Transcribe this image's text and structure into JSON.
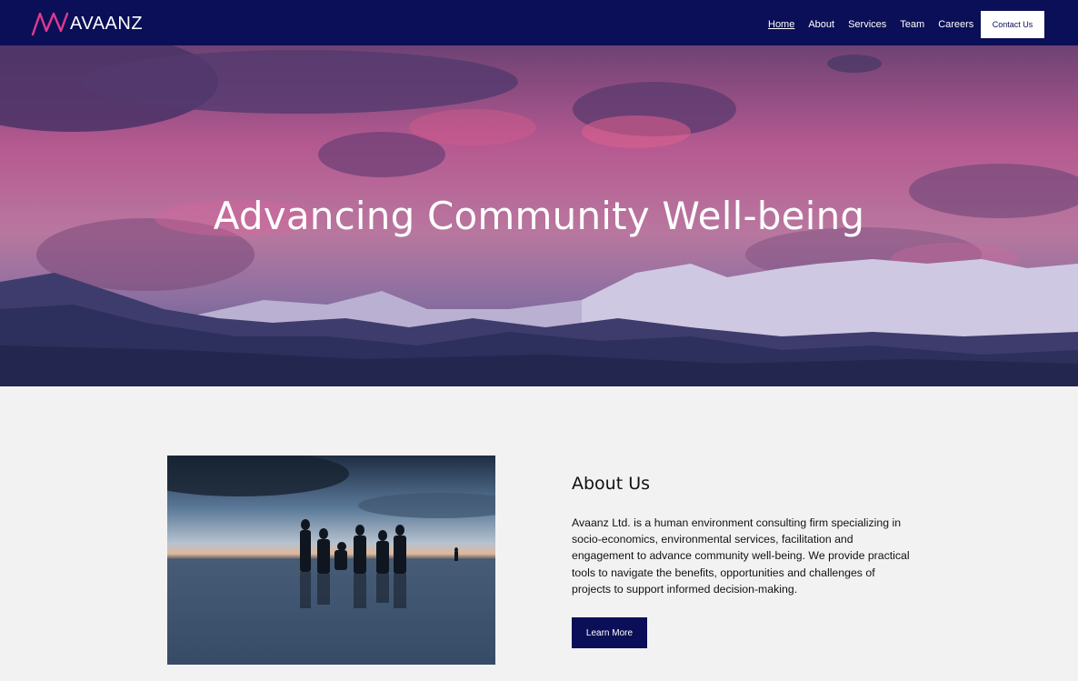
{
  "brand": {
    "name": "AVAANZ",
    "logo_icon": "avaanz-wave-logo",
    "colors": {
      "navy": "#0b0f57",
      "magenta": "#e0398f",
      "white": "#ffffff"
    }
  },
  "nav": {
    "items": [
      {
        "label": "Home",
        "active": true
      },
      {
        "label": "About",
        "active": false
      },
      {
        "label": "Services",
        "active": false
      },
      {
        "label": "Team",
        "active": false
      },
      {
        "label": "Careers",
        "active": false
      }
    ],
    "cta_label": "Contact Us"
  },
  "hero": {
    "title": "Advancing Community Well-being"
  },
  "about": {
    "heading": "About Us",
    "body": "Avaanz Ltd. is a human environment consulting firm specializing in socio-economics, environmental services, facilitation and engagement to advance community well-being. We provide practical tools to navigate the benefits, opportunities and challenges of projects to support informed decision-making.",
    "button_label": "Learn More"
  }
}
